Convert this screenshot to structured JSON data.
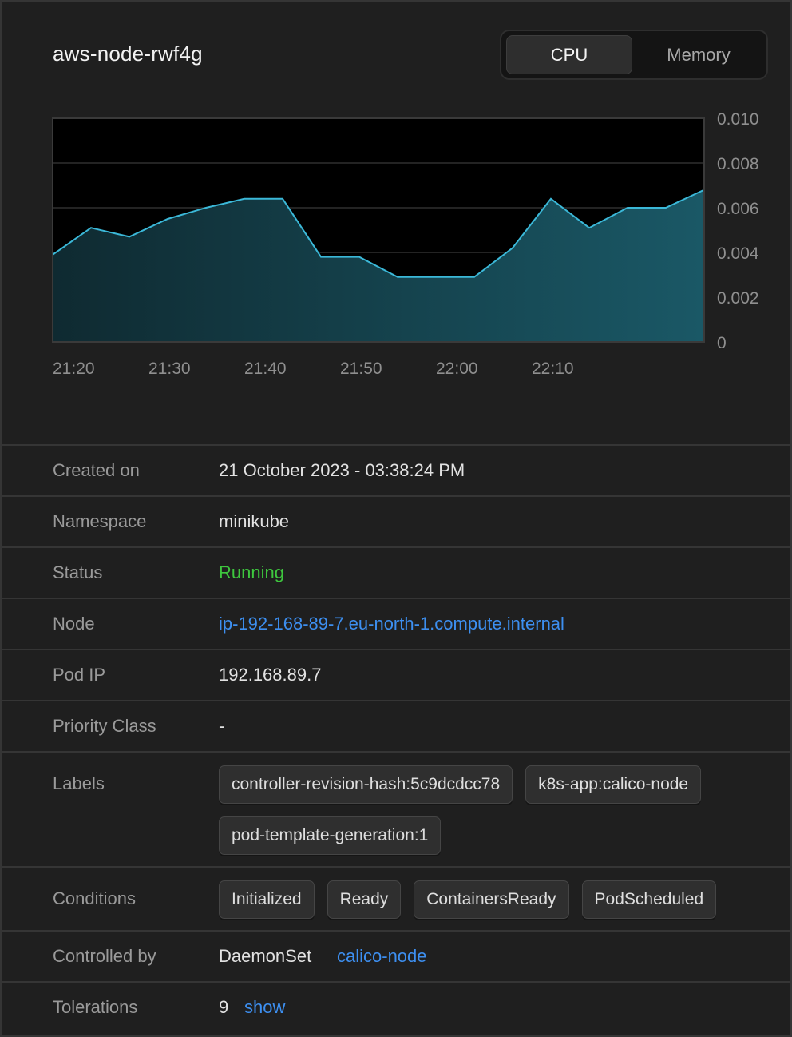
{
  "pod": {
    "name": "aws-node-rwf4g"
  },
  "toggle": {
    "cpu_label": "CPU",
    "memory_label": "Memory",
    "selected": "CPU"
  },
  "colors": {
    "line": "#3bb8d8",
    "fill_top": "#1a5866",
    "fill_bottom": "#0f2a31",
    "status_running": "#3ec63e",
    "link": "#3d8ff0"
  },
  "chart_data": {
    "type": "area",
    "x": [
      "21:17",
      "21:21",
      "21:25",
      "21:29",
      "21:33",
      "21:37",
      "21:41",
      "21:45",
      "21:49",
      "21:53",
      "21:57",
      "22:01",
      "22:05",
      "22:09",
      "22:13",
      "22:17",
      "22:20"
    ],
    "values": [
      0.0039,
      0.0051,
      0.0047,
      0.0055,
      0.006,
      0.0064,
      0.0064,
      0.0038,
      0.0038,
      0.0029,
      0.0029,
      0.0029,
      0.0042,
      0.0064,
      0.0051,
      0.006,
      0.006,
      0.0068
    ],
    "x_ticks": [
      "21:20",
      "21:30",
      "21:40",
      "21:50",
      "22:00",
      "22:10"
    ],
    "y_ticks": [
      "0.010",
      "0.008",
      "0.006",
      "0.004",
      "0.002",
      "0"
    ],
    "ylim": [
      0,
      0.01
    ],
    "grid": true,
    "title": "",
    "xlabel": "",
    "ylabel": ""
  },
  "details": {
    "created_label": "Created on",
    "created_value": "21 October 2023 - 03:38:24 PM",
    "namespace_label": "Namespace",
    "namespace_value": "minikube",
    "status_label": "Status",
    "status_value": "Running",
    "node_label": "Node",
    "node_value": "ip-192-168-89-7.eu-north-1.compute.internal",
    "podip_label": "Pod IP",
    "podip_value": "192.168.89.7",
    "priority_label": "Priority Class",
    "priority_value": "-",
    "labels_label": "Labels",
    "labels": [
      "controller-revision-hash:5c9dcdcc78",
      "k8s-app:calico-node",
      "pod-template-generation:1"
    ],
    "conditions_label": "Conditions",
    "conditions": [
      "Initialized",
      "Ready",
      "ContainersReady",
      "PodScheduled"
    ],
    "controlled_label": "Controlled by",
    "controlled_kind": "DaemonSet",
    "controlled_name": "calico-node",
    "tolerations_label": "Tolerations",
    "tolerations_count": "9",
    "tolerations_action": "show"
  }
}
